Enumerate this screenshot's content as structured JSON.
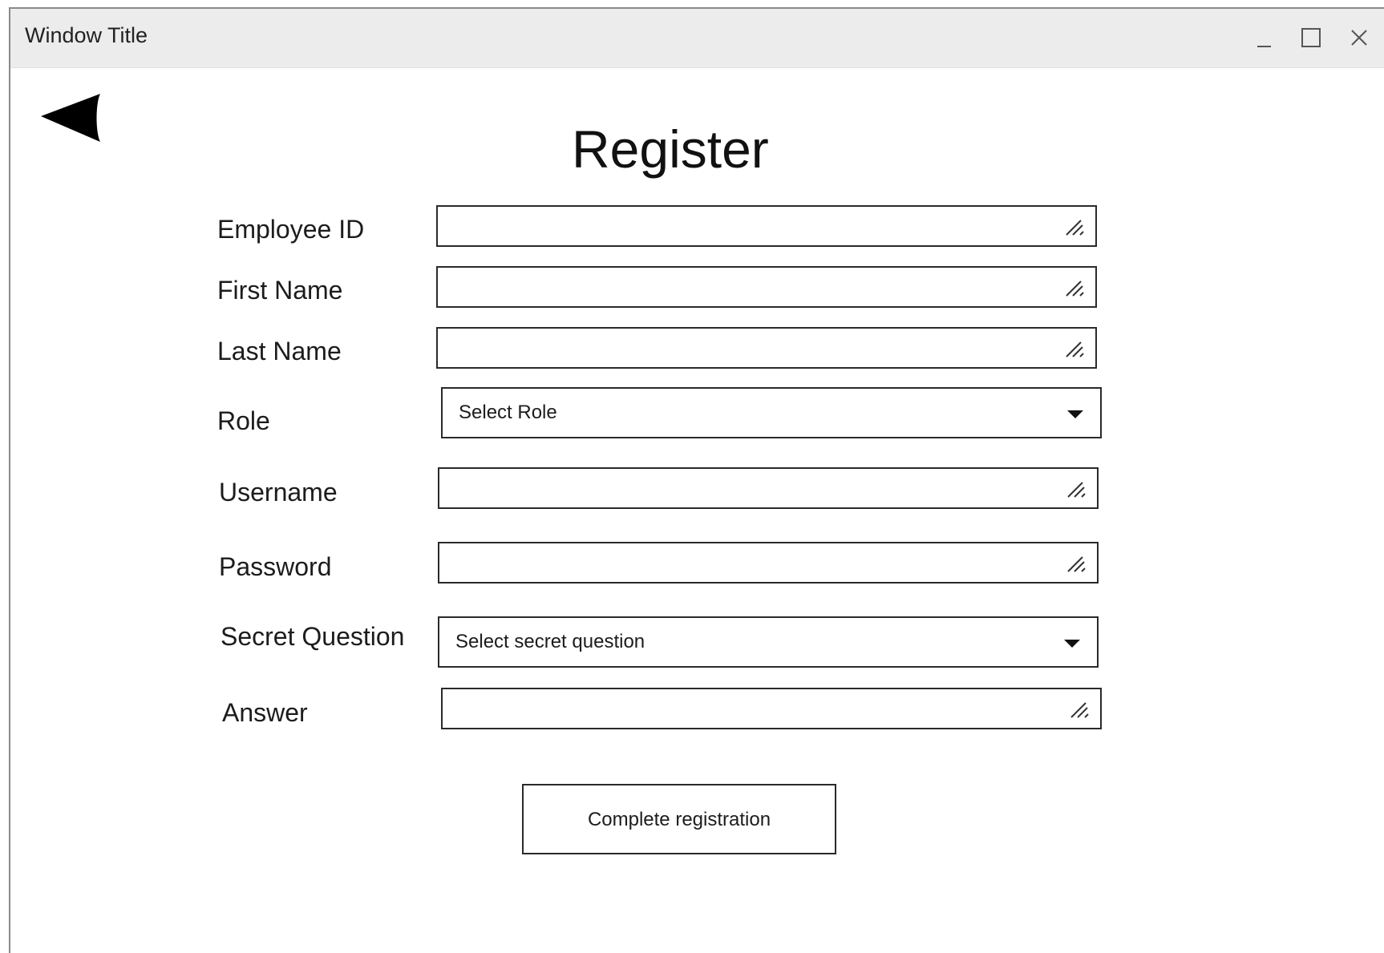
{
  "window": {
    "title": "Window Title",
    "controls": {
      "minimize_icon": "minimize-icon",
      "maximize_icon": "maximize-icon",
      "close_icon": "close-icon"
    }
  },
  "nav": {
    "back_icon": "back-arrow-icon"
  },
  "form": {
    "heading": "Register",
    "fields": {
      "employee_id": {
        "label": "Employee ID",
        "value": ""
      },
      "first_name": {
        "label": "First Name",
        "value": ""
      },
      "last_name": {
        "label": "Last Name",
        "value": ""
      },
      "role": {
        "label": "Role",
        "selected": "Select Role"
      },
      "username": {
        "label": "Username",
        "value": ""
      },
      "password": {
        "label": "Password",
        "value": ""
      },
      "secret_question": {
        "label": "Secret Question",
        "selected": "Select secret question"
      },
      "answer": {
        "label": "Answer",
        "value": ""
      }
    },
    "submit_label": "Complete registration"
  },
  "colors": {
    "titlebar_bg": "#ececec",
    "border": "#2a2a2a",
    "text": "#111111"
  }
}
